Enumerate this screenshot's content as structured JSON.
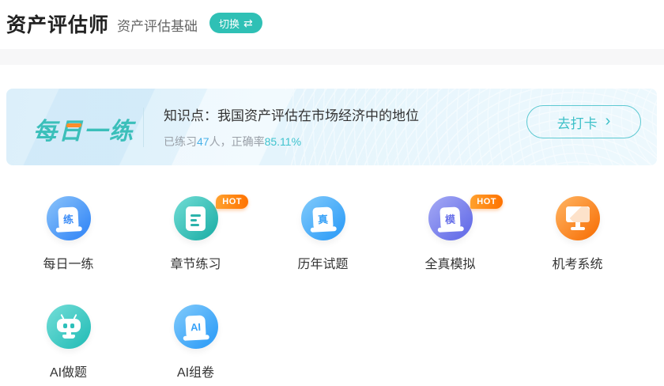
{
  "header": {
    "title": "资产评估师",
    "subject": "资产评估基础",
    "switch_label": "切换",
    "switch_icon": "⇄"
  },
  "banner": {
    "brand": "每日一练",
    "knowledge": "知识点：我国资产评估在市场经济中的地位",
    "stats_prefix": "已练习",
    "stats_count": "47",
    "stats_middle": "人，正确率",
    "stats_rate": "85.11%",
    "cta_label": "去打卡",
    "cta_arrow": "›"
  },
  "badges": {
    "hot": "HOT"
  },
  "menu": {
    "items": [
      {
        "label": "每日一练",
        "glyph": "练",
        "icon": "scroll",
        "color": "#3e8ef7",
        "hot": false
      },
      {
        "label": "章节练习",
        "glyph": "",
        "icon": "document",
        "color": "#2bb3ab",
        "hot": true
      },
      {
        "label": "历年试题",
        "glyph": "真",
        "icon": "scroll",
        "color": "#38a2f8",
        "hot": false
      },
      {
        "label": "全真模拟",
        "glyph": "模",
        "icon": "scroll",
        "color": "#6a72e9",
        "hot": true
      },
      {
        "label": "机考系统",
        "glyph": "",
        "icon": "monitor",
        "color": "#f8760f",
        "hot": false
      },
      {
        "label": "AI做题",
        "glyph": "",
        "icon": "robot",
        "color": "#2cc0ba",
        "hot": false
      },
      {
        "label": "AI组卷",
        "glyph": "AI",
        "icon": "scroll",
        "color": "#38a2f8",
        "hot": false
      }
    ]
  },
  "colors": {
    "accent_teal": "#2fc0b5",
    "banner_brand_teal": "#3bbfba",
    "brand_accent_orange": "#ff8d2a",
    "stats_count_blue": "#49b1e8",
    "stats_rate_cyan": "#3fc3ce",
    "hot_orange": "#ff7200",
    "banner_bg": "#e4f4fc",
    "separator_gray": "#f7f7f8"
  }
}
